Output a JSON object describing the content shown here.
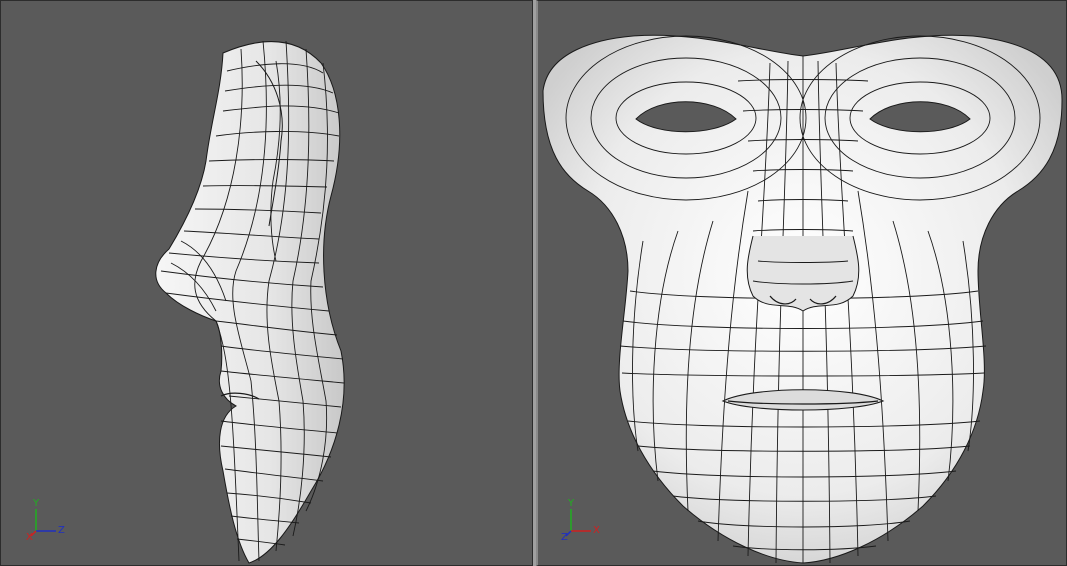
{
  "viewports": {
    "left": {
      "view": "side",
      "model": "face-mask-mesh",
      "axes": {
        "up": "Y",
        "horizontal": "Z",
        "depth": "X"
      }
    },
    "right": {
      "view": "front",
      "model": "face-mask-mesh",
      "axes": {
        "up": "Y",
        "horizontal": "X",
        "depth": "Z"
      }
    }
  },
  "colors": {
    "viewport_bg": "#5a5a5a",
    "mesh_fill": "#ececec",
    "wire": "#1a1a1a",
    "axis_x": "#d02020",
    "axis_y": "#20b020",
    "axis_z": "#2030c0"
  }
}
